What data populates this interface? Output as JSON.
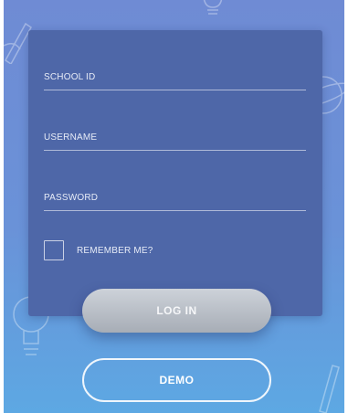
{
  "form": {
    "school_id_label": "SCHOOL ID",
    "username_label": "USERNAME",
    "password_label": "PASSWORD",
    "remember_label": "REMEMBER ME?",
    "remember_checked": false
  },
  "buttons": {
    "login_label": "LOG IN",
    "demo_label": "DEMO"
  },
  "colors": {
    "background_top": "#6f8bd4",
    "background_bottom": "#5da8e3",
    "card": "#4e67a8",
    "login_button": "#b8bdc5"
  },
  "decorations": [
    "lightbulb-doodle",
    "planet-doodle",
    "pencil-doodle"
  ]
}
